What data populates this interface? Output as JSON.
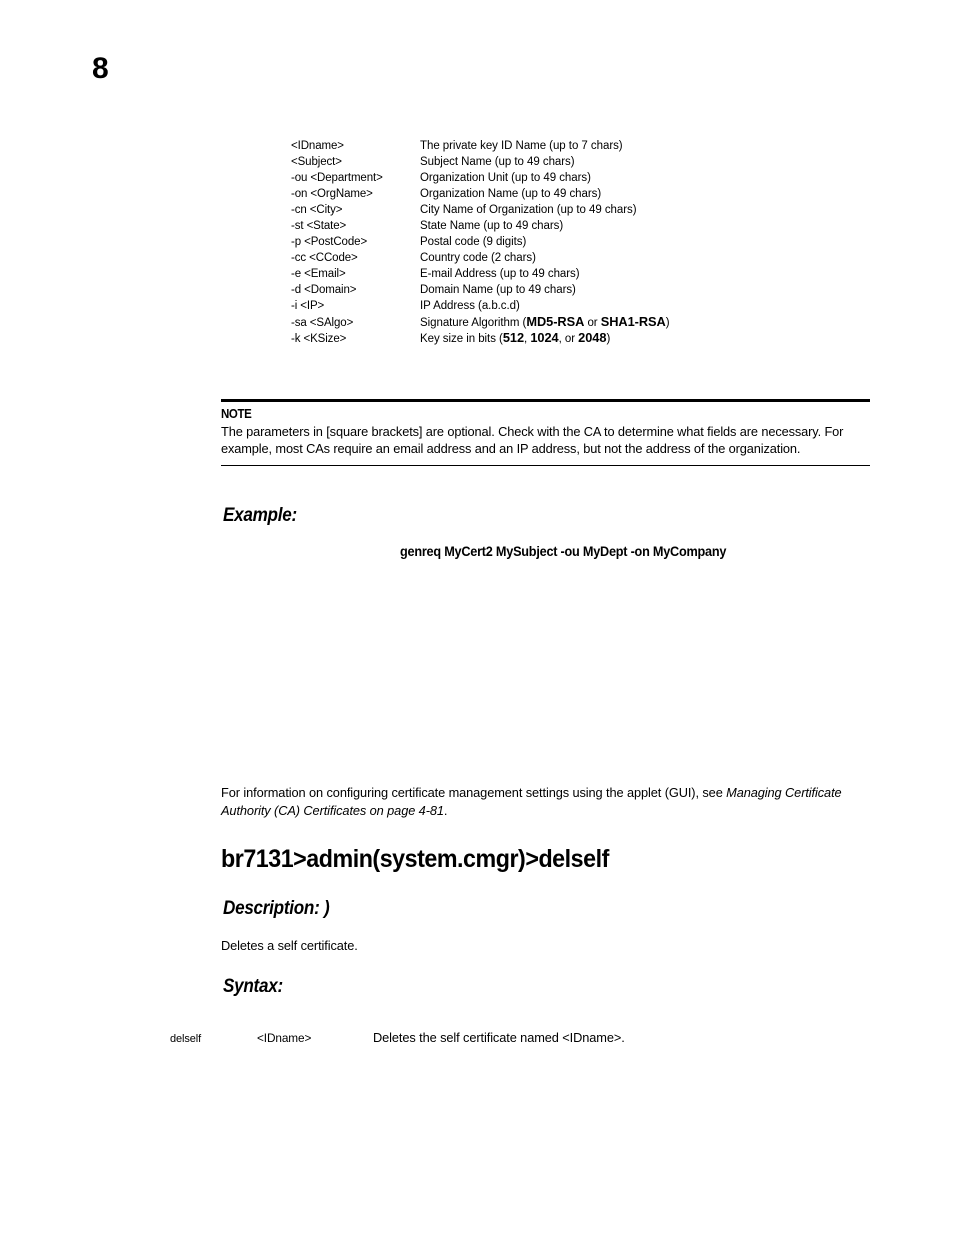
{
  "page": {
    "number": "8"
  },
  "parameters": [
    {
      "term": "<IDname>",
      "desc": "The private key ID Name (up to 7 chars)"
    },
    {
      "term": "<Subject>",
      "desc": "Subject Name (up to 49 chars)"
    },
    {
      "term": "-ou <Department>",
      "desc": "Organization Unit (up to 49 chars)"
    },
    {
      "term": "-on <OrgName>",
      "desc": "Organization Name (up to 49 chars)"
    },
    {
      "term": "-cn <City>",
      "desc": "City Name of Organization (up to 49 chars)"
    },
    {
      "term": "-st <State>",
      "desc": "State Name (up to 49 chars)"
    },
    {
      "term": "-p <PostCode>",
      "desc": "Postal code (9 digits)"
    },
    {
      "term": "-cc <CCode>",
      "desc": "Country code (2 chars)"
    },
    {
      "term": "-e <Email>",
      "desc": "E-mail Address (up to 49 chars)"
    },
    {
      "term": "-d <Domain>",
      "desc": "Domain Name (up to 49 chars)"
    },
    {
      "term": "-i <IP>",
      "desc": "IP Address (a.b.c.d)"
    },
    {
      "term": "-sa <SAlgo>",
      "desc": "Signature Algorithm (MD5-RSA or SHA1-RSA)",
      "desc_parts": [
        {
          "text": "Signature Algorithm (",
          "bold": false
        },
        {
          "text": "MD5-RSA",
          "bold": true
        },
        {
          "text": " or ",
          "bold": false
        },
        {
          "text": "SHA1-RSA",
          "bold": true
        },
        {
          "text": ")",
          "bold": false
        }
      ]
    },
    {
      "term": "-k <KSize>",
      "desc": "Key size in bits (512, 1024, or 2048)",
      "desc_parts": [
        {
          "text": "Key size in bits (",
          "bold": false
        },
        {
          "text": "512",
          "bold": true
        },
        {
          "text": ", ",
          "bold": false
        },
        {
          "text": "1024",
          "bold": true
        },
        {
          "text": ", or ",
          "bold": false
        },
        {
          "text": "2048",
          "bold": true
        },
        {
          "text": ")",
          "bold": false
        }
      ]
    }
  ],
  "note": {
    "label": "NOTE",
    "text": "The parameters in [square brackets] are optional. Check with the CA to determine what fields are necessary. For example, most CAs require an email address and an IP address, but not the address of the organization."
  },
  "example": {
    "heading": "Example:",
    "command": "genreq MyCert2 MySubject -ou MyDept -on MyCompany"
  },
  "cross_reference": {
    "lead_text": "For information on configuring certificate management settings using the applet (GUI), see ",
    "italic_text": "Managing Certificate Authority (CA) Certificates on page 4-81",
    "trailing_text": "."
  },
  "command_section": {
    "heading": "br7131>admin(system.cmgr)>delself",
    "description_heading": "Description: )",
    "description_text": "Deletes a self certificate.",
    "syntax_heading": "Syntax:",
    "syntax_row": {
      "command": "delself",
      "argument": "<IDname>",
      "description": "Deletes the self certificate named <IDname>."
    }
  }
}
